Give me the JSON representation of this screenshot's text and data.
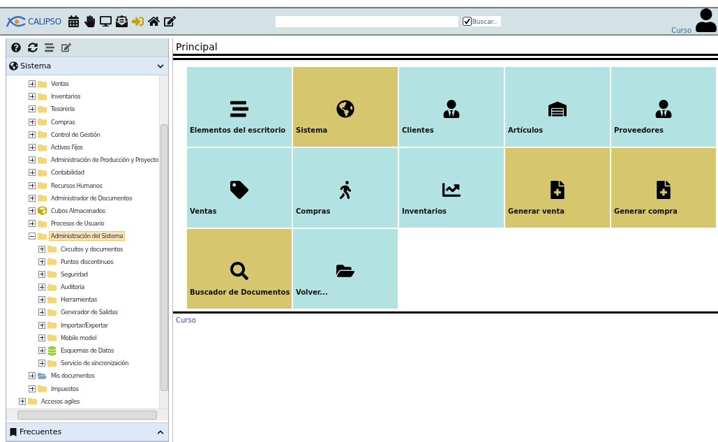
{
  "topbar": {
    "logo": "CALIPSO",
    "search": {
      "checked": true,
      "button": "Buscar.."
    },
    "user": "Curso"
  },
  "sidebar": {
    "section": {
      "title": "Sistema",
      "expanded": true
    },
    "tree": [
      {
        "children": [
          {
            "label": "Ventas",
            "kind": "folder",
            "expanded": false,
            "selected": false
          },
          {
            "label": "Inventarios",
            "kind": "folder",
            "expanded": false,
            "selected": false
          },
          {
            "label": "Tesorería",
            "kind": "folder",
            "expanded": false,
            "selected": false
          },
          {
            "label": "Compras",
            "kind": "folder",
            "expanded": false,
            "selected": false
          },
          {
            "label": "Control de Gestión",
            "kind": "folder",
            "expanded": false,
            "selected": false
          },
          {
            "label": "Activos Fijos",
            "kind": "folder",
            "expanded": false,
            "selected": false
          },
          {
            "label": "Administración de Producción y Proyecto",
            "kind": "folder",
            "expanded": false,
            "selected": false
          },
          {
            "label": "Contabilidad",
            "kind": "folder",
            "expanded": false,
            "selected": false
          },
          {
            "label": "Recursos Humanos",
            "kind": "folder",
            "expanded": false,
            "selected": false
          },
          {
            "label": "Administrador de Documentos",
            "kind": "folder",
            "expanded": false,
            "selected": false
          },
          {
            "label": "Cubos Almacenados",
            "kind": "cube",
            "expanded": false,
            "selected": false
          },
          {
            "label": "Procesos de Usuario",
            "kind": "folder",
            "expanded": false,
            "selected": false
          },
          {
            "label": "Administración del Sistema",
            "kind": "folder",
            "expanded": true,
            "selected": true,
            "children": [
              {
                "label": "Circuitos y documentos",
                "kind": "folder",
                "expanded": false,
                "selected": false
              },
              {
                "label": "Puntos discontinuos",
                "kind": "folder",
                "expanded": false,
                "selected": false
              },
              {
                "label": "Seguridad",
                "kind": "folder",
                "expanded": false,
                "selected": false
              },
              {
                "label": "Auditoria",
                "kind": "folder",
                "expanded": false,
                "selected": false
              },
              {
                "label": "Herramientas",
                "kind": "folder",
                "expanded": false,
                "selected": false
              },
              {
                "label": "Generador de Salidas",
                "kind": "folder",
                "expanded": false,
                "selected": false
              },
              {
                "label": "Importar/Exportar",
                "kind": "folder",
                "expanded": false,
                "selected": false
              },
              {
                "label": "Mobile model",
                "kind": "folder",
                "expanded": false,
                "selected": false
              },
              {
                "label": "Esquemas de Datos",
                "kind": "schema",
                "expanded": false,
                "selected": false
              },
              {
                "label": "Servicio de sincronización",
                "kind": "folder",
                "expanded": false,
                "selected": false
              }
            ]
          },
          {
            "label": "Mis documentos",
            "kind": "mydocs",
            "expanded": false,
            "selected": false
          },
          {
            "label": "Impuestos",
            "kind": "folder",
            "expanded": false,
            "selected": false
          }
        ]
      },
      {
        "label": "Accesos agiles",
        "kind": "folder",
        "expanded": false,
        "selected": false
      }
    ],
    "footer": {
      "title": "Frecuentes",
      "expanded": false
    }
  },
  "main": {
    "title": "Principal",
    "tiles": [
      {
        "label": "Elementos del escritorio",
        "color": "#b3e2e2"
      },
      {
        "label": "Sistema",
        "color": "#d6c76f"
      },
      {
        "label": "Clientes",
        "color": "#b3e2e2"
      },
      {
        "label": "Artículos",
        "color": "#b3e2e2"
      },
      {
        "label": "Proveedores",
        "color": "#b3e2e2"
      },
      {
        "label": "Ventas",
        "color": "#b3e2e2"
      },
      {
        "label": "Compras",
        "color": "#b3e2e2"
      },
      {
        "label": "Inventarios",
        "color": "#b3e2e2"
      },
      {
        "label": "Generar venta",
        "color": "#d6c76f"
      },
      {
        "label": "Generar compra",
        "color": "#d6c76f"
      },
      {
        "label": "Buscador de Documentos",
        "color": "#d6c76f"
      },
      {
        "label": "Volver...",
        "color": "#b3e2e2"
      }
    ],
    "footer": "Curso"
  }
}
